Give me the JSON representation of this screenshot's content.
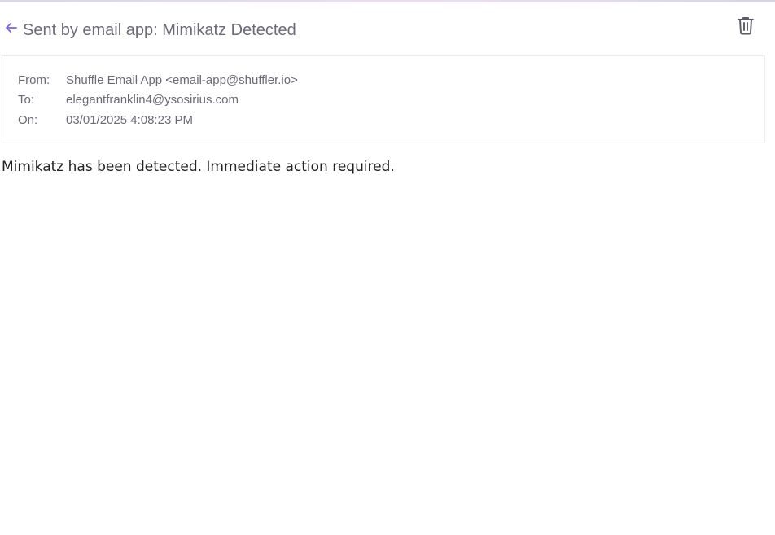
{
  "email": {
    "subject": "Sent by email app: Mimikatz Detected",
    "from_label": "From:",
    "from_value": "Shuffle Email App <email-app@shuffler.io>",
    "to_label": "To:",
    "to_value": "elegantfranklin4@ysosirius.com",
    "on_label": "On:",
    "on_value": "03/01/2025 4:08:23 PM",
    "body": "Mimikatz has been detected. Immediate action required."
  },
  "icons": {
    "back": "arrow-left-icon",
    "delete": "trash-icon"
  },
  "colors": {
    "accent": "#7b5cf0",
    "text_muted": "#6b6b78",
    "text_body": "#222222",
    "icon": "#5a5a66"
  }
}
